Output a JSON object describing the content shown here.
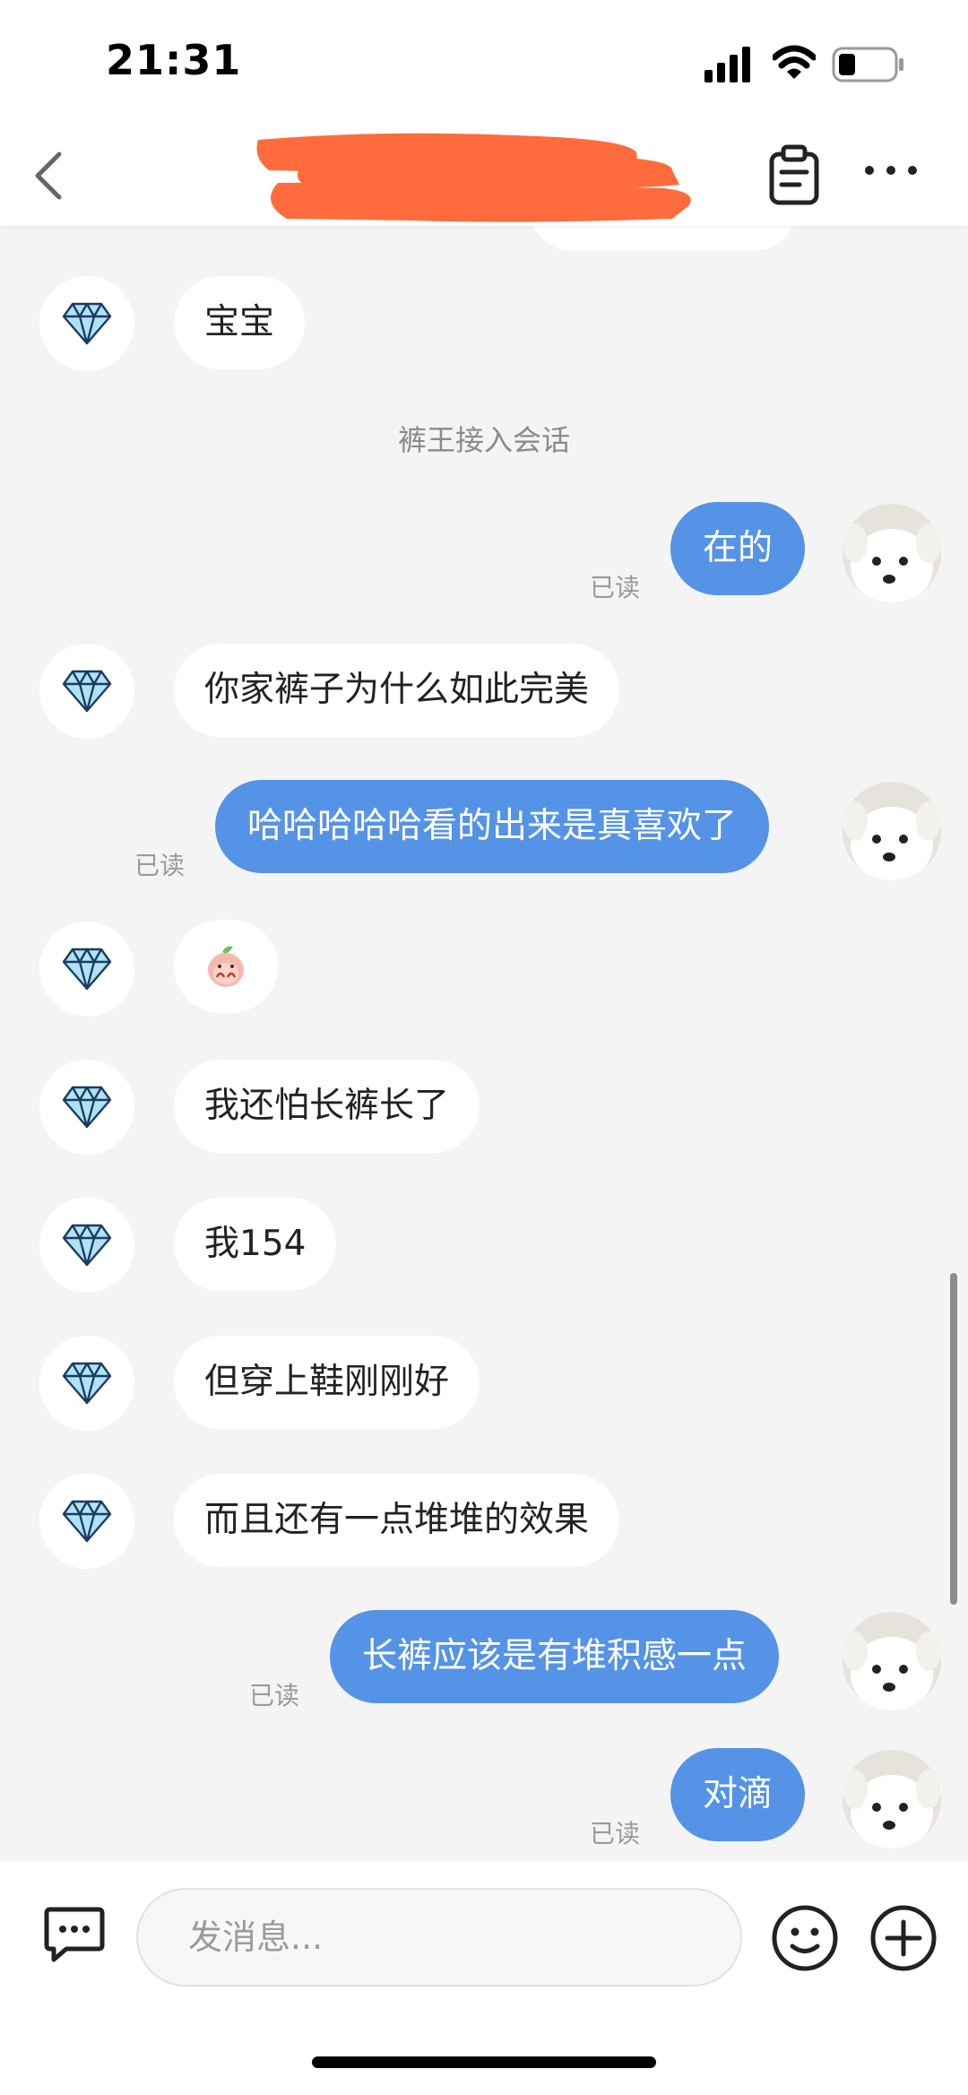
{
  "status_bar": {
    "time": "21:31"
  },
  "header": {
    "title": ""
  },
  "system_message": "裤王接入会话",
  "messages": [
    {
      "side": "in",
      "text": "宝宝"
    },
    {
      "side": "out",
      "text": "在的",
      "status": "已读"
    },
    {
      "side": "in",
      "text": "你家裤子为什么如此完美"
    },
    {
      "side": "out",
      "text": "哈哈哈哈哈看的出来是真喜欢了",
      "status": "已读"
    },
    {
      "side": "in",
      "text": ""
    },
    {
      "side": "in",
      "text": "我还怕长裤长了"
    },
    {
      "side": "in",
      "text": "我154"
    },
    {
      "side": "in",
      "text": "但穿上鞋刚刚好"
    },
    {
      "side": "in",
      "text": "而且还有一点堆堆的效果"
    },
    {
      "side": "out",
      "text": "长裤应该是有堆积感一点",
      "status": "已读"
    },
    {
      "side": "out",
      "text": "对滴",
      "status": "已读"
    }
  ],
  "input": {
    "placeholder": "发消息..."
  },
  "icons": {
    "back": "chevron-left-icon",
    "clipboard": "clipboard-icon",
    "more": "more-dots-icon",
    "avatar_in": "diamond-icon",
    "avatar_out": "puppy-avatar",
    "sticker": "peach-sticker",
    "chat": "chat-bubble-icon",
    "emoji": "smiley-icon",
    "plus": "plus-circle-icon"
  },
  "colors": {
    "out_bubble": "#5593e6",
    "in_bubble": "#ffffff",
    "background": "#f4f4f4",
    "redaction": "#ff6b3d"
  }
}
